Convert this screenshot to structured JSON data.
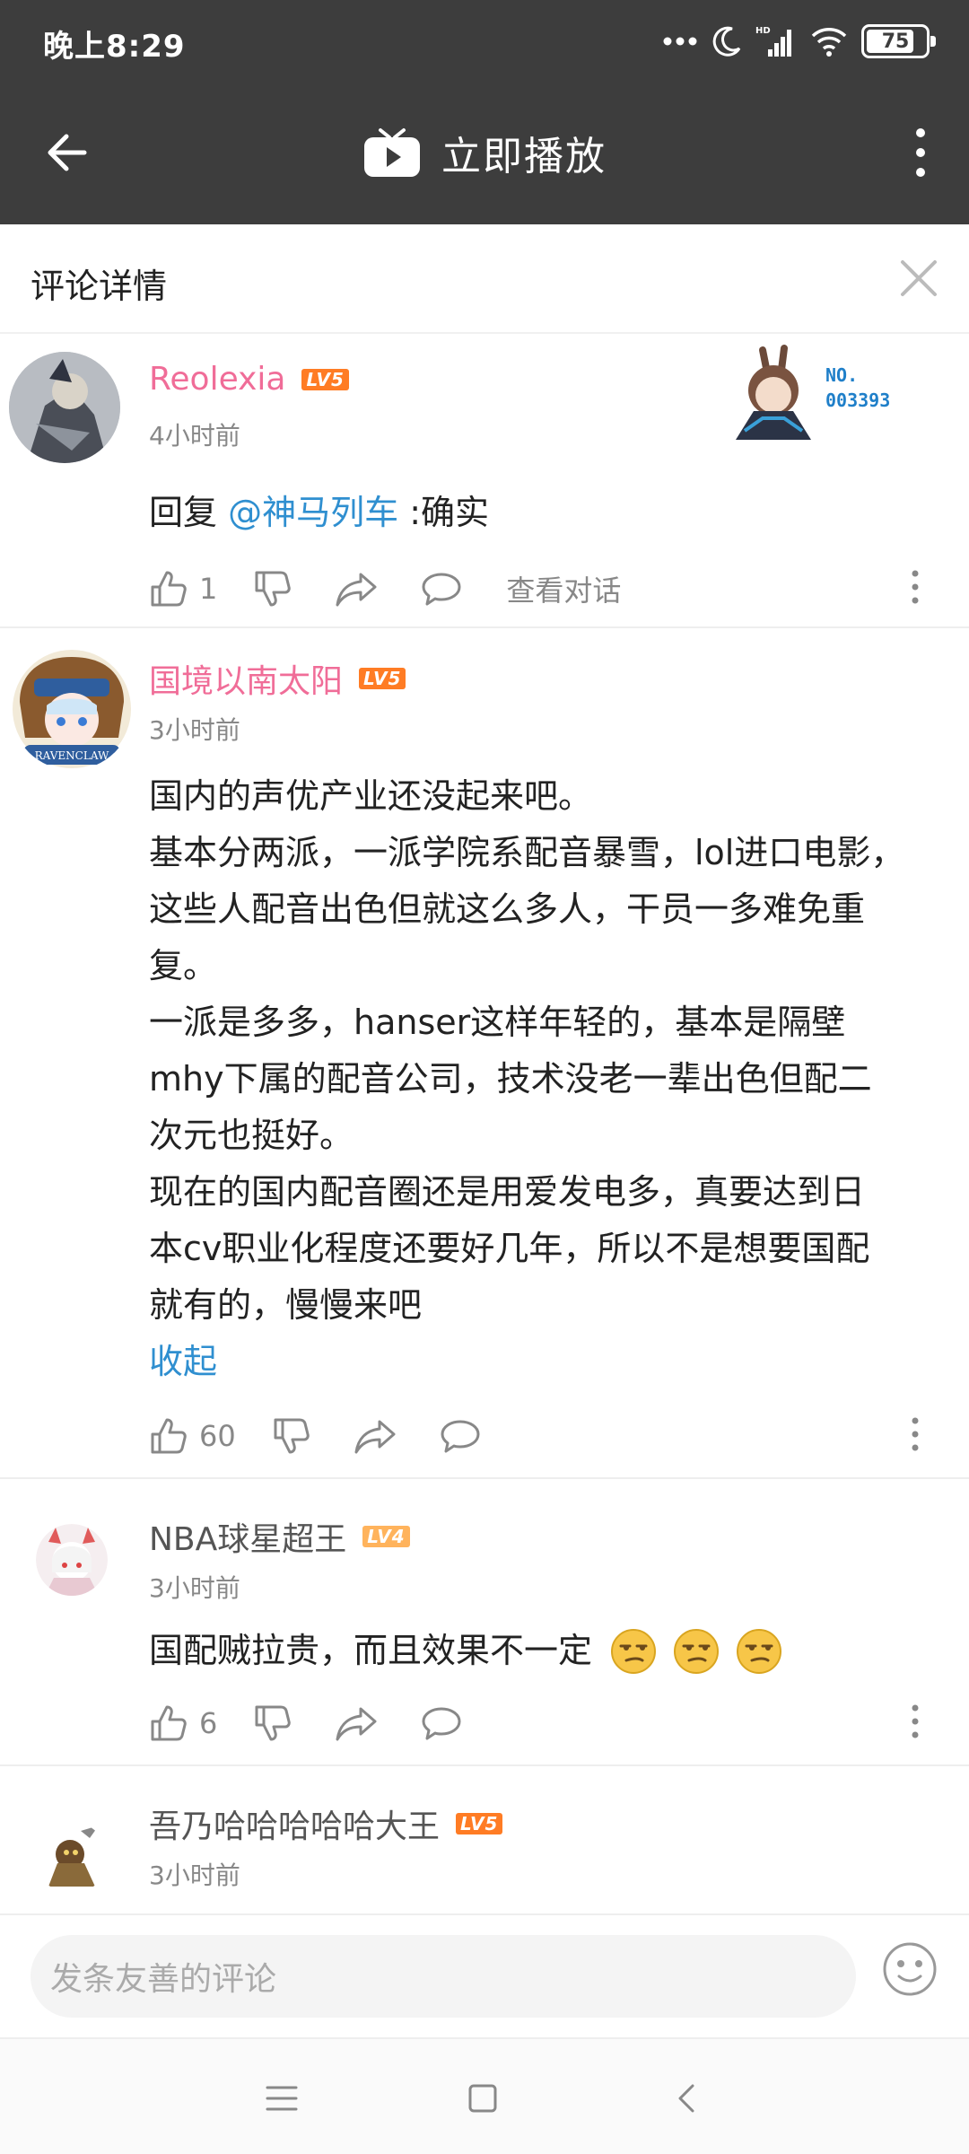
{
  "status_bar": {
    "time": "晚上8:29",
    "battery": "75",
    "icons": [
      "more-dots-icon",
      "moon-icon",
      "hd-signal-icon",
      "wifi-icon",
      "battery-icon"
    ]
  },
  "app_bar": {
    "back_icon": "arrow-left-icon",
    "title": "立即播放",
    "more_icon": "vertical-dots-icon"
  },
  "detail": {
    "title": "评论详情",
    "close_icon": "close-icon"
  },
  "comments": [
    {
      "username": "Reolexia",
      "level": "LV5",
      "time": "4小时前",
      "medal_label": "NO.",
      "medal_number": "003393",
      "text_prefix": "回复 ",
      "mention": "@神马列车",
      "text_suffix": " :确实",
      "likes": "1",
      "view_conversation": "查看对话"
    },
    {
      "username": "国境以南太阳",
      "level": "LV5",
      "time": "3小时前",
      "avatar_text": "RAVENCLAW",
      "lines": [
        "国内的声优产业还没起来吧。",
        "基本分两派，一派学院系配音暴雪，lol进口电影，",
        "这些人配音出色但就这么多人，干员一多难免重",
        "复。",
        "一派是多多，hanser这样年轻的，基本是隔壁",
        "mhy下属的配音公司，技术没老一辈出色但配二",
        "次元也挺好。",
        "现在的国内配音圈还是用爱发电多，真要达到日",
        "本cv职业化程度还要好几年，所以不是想要国配",
        "就有的，慢慢来吧"
      ],
      "collapse": "收起",
      "likes": "60"
    },
    {
      "username": "NBA球星超王",
      "level": "LV4",
      "time": "3小时前",
      "text": "国配贼拉贵，而且效果不一定",
      "likes": "6"
    },
    {
      "username": "吾乃哈哈哈哈哈大王",
      "level": "LV5",
      "time": "3小时前"
    }
  ],
  "input": {
    "placeholder": "发条友善的评论",
    "emoji_icon": "emoji-face-icon"
  },
  "nav": {
    "icons": [
      "menu-icon",
      "home-square-icon",
      "back-chevron-icon"
    ]
  },
  "colors": {
    "bar_bg": "#3d3d3d",
    "vip_name": "#f06d98",
    "link": "#2f8fd0",
    "level5": "#ff7c24",
    "level4": "#ffb35c"
  }
}
